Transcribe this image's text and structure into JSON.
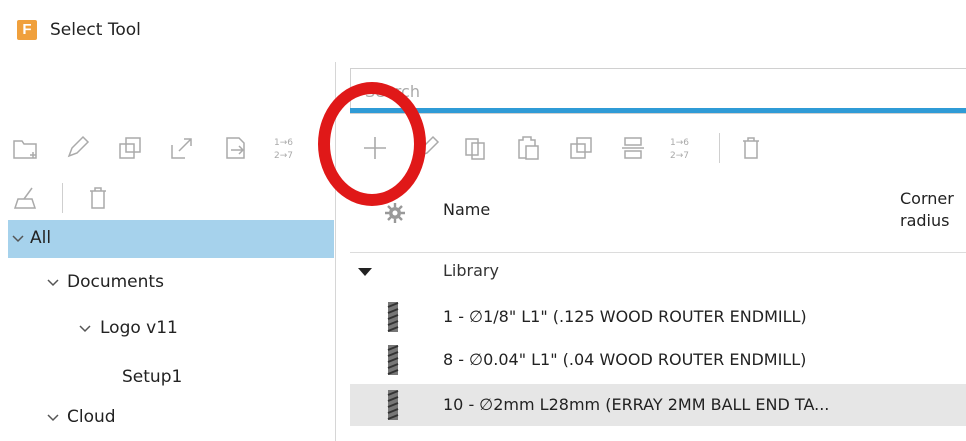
{
  "window": {
    "app_logo": "F",
    "title": "Select Tool"
  },
  "search": {
    "placeholder": "Search",
    "value": ""
  },
  "tree": {
    "items": [
      {
        "label": "All",
        "level": 0,
        "expanded": true,
        "selected": true
      },
      {
        "label": "Documents",
        "level": 1,
        "expanded": true
      },
      {
        "label": "Logo v11",
        "level": 2,
        "expanded": true
      },
      {
        "label": "Setup1",
        "level": 3
      },
      {
        "label": "Cloud",
        "level": 1,
        "expanded": true
      }
    ]
  },
  "left_toolbar": {
    "icons": [
      "new-folder-icon",
      "edit-icon",
      "duplicate-icon",
      "export-icon",
      "import-icon",
      "renumber-icon",
      "clean-icon",
      "delete-icon"
    ],
    "renumber_top": "1→6",
    "renumber_bottom": "2→7"
  },
  "right_toolbar": {
    "icons": [
      "add-icon",
      "edit-icon",
      "copy-icon",
      "paste-icon",
      "duplicate-icon",
      "holder-icon",
      "renumber-icon",
      "delete-icon"
    ],
    "renumber_top": "1→6",
    "renumber_bottom": "2→7"
  },
  "columns": {
    "name": "Name",
    "corner_radius_line1": "Corner",
    "corner_radius_line2": "radius"
  },
  "library": {
    "label": "Library"
  },
  "tools": [
    {
      "name": "1 - ∅1/8\" L1\" (.125 WOOD ROUTER ENDMILL)"
    },
    {
      "name": "8 - ∅0.04\" L1\" (.04 WOOD ROUTER ENDMILL)"
    },
    {
      "name": "10 - ∅2mm L28mm (ERRAY 2MM BALL END TA...",
      "highlighted": true
    }
  ],
  "colors": {
    "selection": "#a6d2ec",
    "accent": "#2f9bd6",
    "annotation": "#e01818",
    "logo": "#f0a03c"
  }
}
